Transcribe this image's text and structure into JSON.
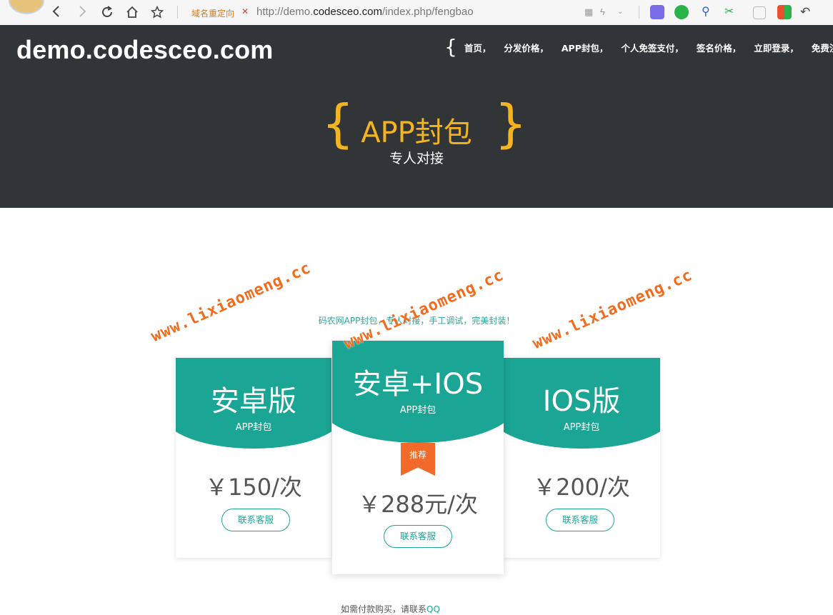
{
  "browser": {
    "redirect_label": "域名重定向",
    "url_prefix": "http://demo.",
    "url_host": "codesceo.com",
    "url_path": "/index.php/fengbao"
  },
  "header": {
    "logo": "demo.codesceo.com",
    "nav": [
      "首页，",
      "分发价格，",
      "APP封包，",
      "个人免签支付，",
      "签名价格，",
      "立即登录，",
      "免费注册"
    ],
    "brace_open": "{",
    "brace_close": "}",
    "hero_title": "APP封包",
    "hero_subtitle": "专人对接"
  },
  "intro": "码农网APP封包，专人对接，手工调试，完美封装！",
  "watermark": "www.lixiaomeng.cc",
  "plans": [
    {
      "name": "安卓版",
      "tag": "APP封包",
      "price": "￥150/次",
      "button": "联系客服"
    },
    {
      "name": "安卓+IOS",
      "tag": "APP封包",
      "badge": "推荐",
      "price": "￥288元/次",
      "button": "联系客服"
    },
    {
      "name": "IOS版",
      "tag": "APP封包",
      "price": "￥200/次",
      "button": "联系客服"
    }
  ],
  "footer_note": {
    "text": "如需付款购买，请联系",
    "qq": "QQ"
  },
  "colors": {
    "header_bg": "#313538",
    "accent_yellow": "#f2b420",
    "teal": "#1aa594",
    "ribbon": "#f26a2a",
    "watermark": "#f26a1b"
  }
}
